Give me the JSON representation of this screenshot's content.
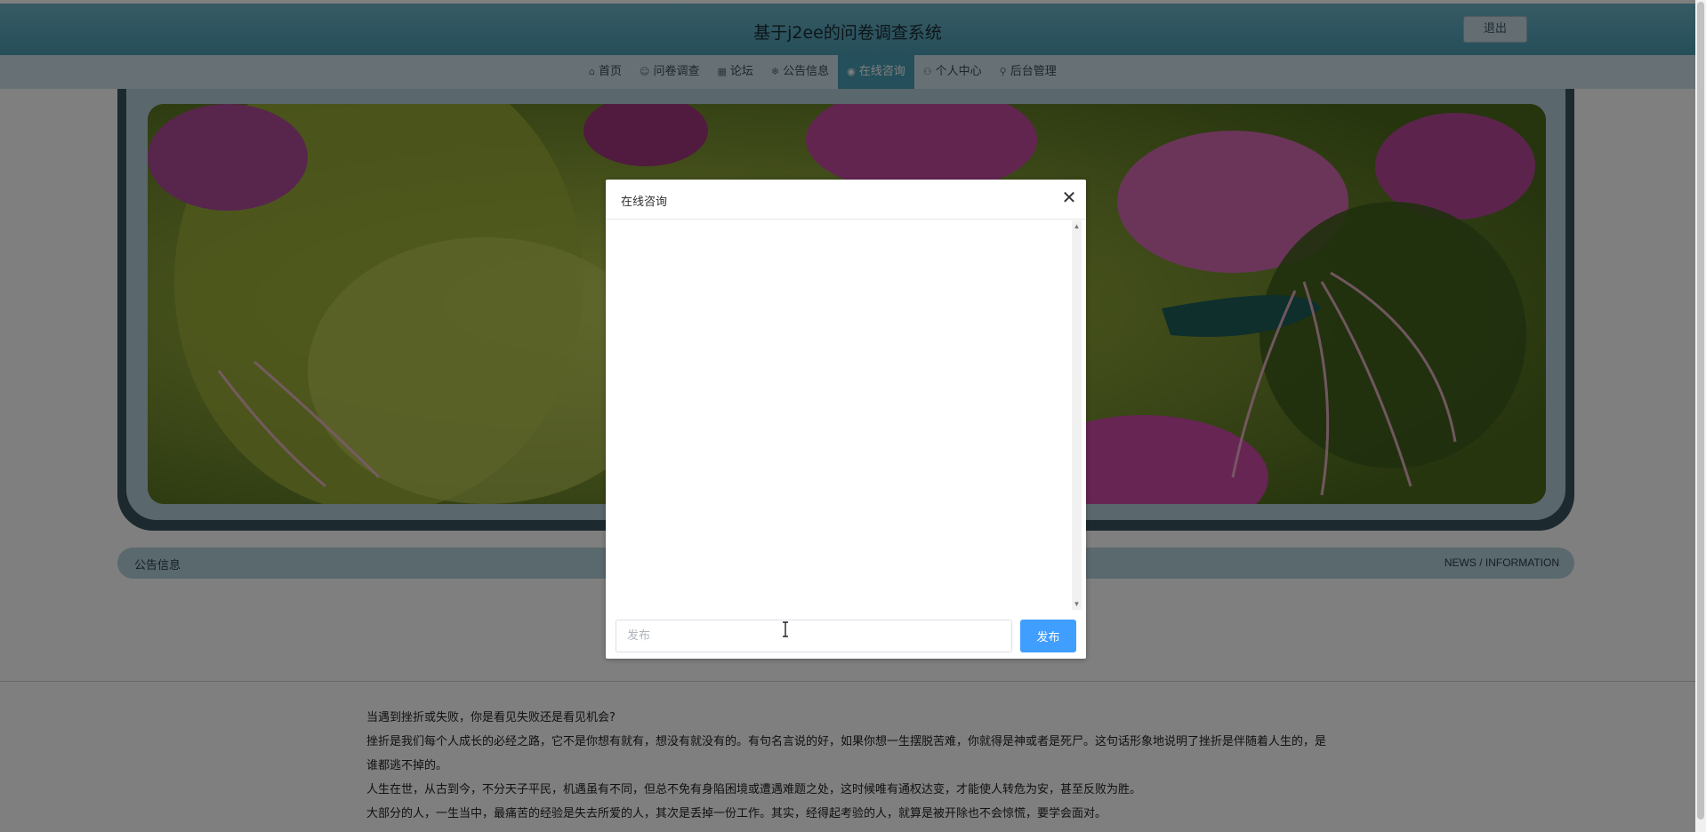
{
  "header": {
    "title": "基于j2ee的问卷调查系统",
    "logout_label": "退出"
  },
  "nav": {
    "items": [
      {
        "label": "首页",
        "icon": "home-icon",
        "glyph": "⌂"
      },
      {
        "label": "问卷调查",
        "icon": "survey-icon",
        "glyph": "☺"
      },
      {
        "label": "论坛",
        "icon": "forum-icon",
        "glyph": "▦"
      },
      {
        "label": "公告信息",
        "icon": "notice-icon",
        "glyph": "❄"
      },
      {
        "label": "在线咨询",
        "icon": "chat-icon",
        "glyph": "◉",
        "active": true
      },
      {
        "label": "个人中心",
        "icon": "user-icon",
        "glyph": "⚇"
      },
      {
        "label": "后台管理",
        "icon": "link-icon",
        "glyph": "⚲"
      }
    ]
  },
  "notice": {
    "title": "公告信息",
    "subtitle": "NEWS / INFORMATION"
  },
  "article": {
    "paragraphs": [
      "当遇到挫折或失败，你是看见失败还是看见机会?",
      "挫折是我们每个人成长的必经之路，它不是你想有就有，想没有就没有的。有句名言说的好，如果你想一生摆脱苦难，你就得是神或者是死尸。这句话形象地说明了挫折是伴随着人生的，是谁都逃不掉的。",
      "人生在世，从古到今，不分天子平民，机遇虽有不同，但总不免有身陷困境或遭遇难题之处，这时候唯有通权达变，才能使人转危为安，甚至反败为胜。",
      "大部分的人，一生当中，最痛苦的经验是失去所爱的人，其次是丢掉一份工作。其实，经得起考验的人，就算是被开除也不会惊慌，要学会面对。"
    ]
  },
  "dialog": {
    "title": "在线咨询",
    "input_placeholder": "发布",
    "publish_label": "发布"
  },
  "colors": {
    "header": "#4a9db4",
    "nav": "#cfe3ea",
    "nav_active": "#4b9fb5",
    "primary_button": "#409eff"
  }
}
